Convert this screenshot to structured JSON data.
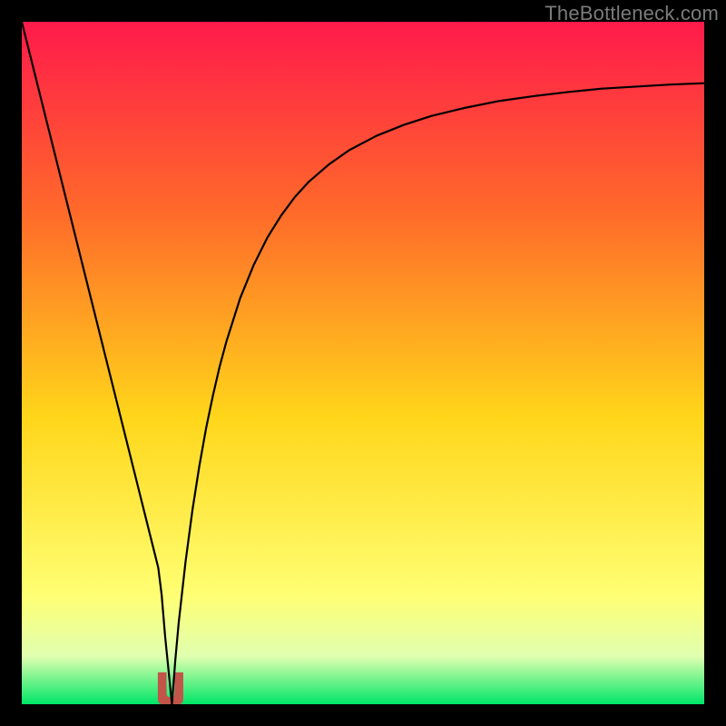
{
  "watermark": "TheBottleneck.com",
  "colors": {
    "gradient_top": "#ff1a4b",
    "gradient_mid1": "#ff6a2a",
    "gradient_mid2": "#ffd61a",
    "gradient_mid3": "#ffff73",
    "gradient_bottom_band": "#e0ffb0",
    "gradient_bottom": "#00e667",
    "curve": "#000000",
    "marker": "#c1554a",
    "frame_bg": "#000000"
  },
  "chart_data": {
    "type": "line",
    "title": "",
    "xlabel": "",
    "ylabel": "",
    "xlim": [
      0,
      100
    ],
    "ylim": [
      0,
      100
    ],
    "curve_samples_x": [
      0,
      1,
      2,
      3,
      4,
      5,
      6,
      7,
      8,
      9,
      10,
      11,
      12,
      13,
      14,
      15,
      16,
      17,
      18,
      19.5,
      20,
      20.5,
      21,
      21.2,
      21.4,
      21.6,
      21.7,
      21.8,
      21.9,
      22,
      22.5,
      23,
      24,
      25,
      26,
      27,
      28,
      29,
      30,
      32,
      34,
      36,
      38,
      40,
      42,
      45,
      48,
      52,
      56,
      60,
      65,
      70,
      75,
      80,
      85,
      90,
      95,
      100
    ],
    "curve_samples_y": [
      100,
      96.0,
      92.0,
      88.0,
      84.0,
      80.0,
      76.0,
      72.0,
      68.0,
      64.0,
      60.0,
      56.0,
      52.0,
      48.0,
      44.0,
      40.0,
      36.0,
      32.0,
      28.0,
      22.0,
      20.0,
      16.0,
      10.0,
      8.0,
      6.0,
      4.0,
      3.0,
      2.0,
      1.0,
      0.0,
      6.5,
      12.0,
      20.9,
      28.4,
      34.8,
      40.4,
      45.2,
      49.5,
      53.2,
      59.5,
      64.4,
      68.4,
      71.6,
      74.3,
      76.5,
      79.1,
      81.2,
      83.3,
      84.9,
      86.2,
      87.4,
      88.4,
      89.1,
      89.7,
      90.2,
      90.5,
      90.8,
      91.0
    ],
    "marker": {
      "x_center": 21.8,
      "width": 3.6,
      "y_top": 4.6,
      "y_bottom": 0.0
    }
  }
}
